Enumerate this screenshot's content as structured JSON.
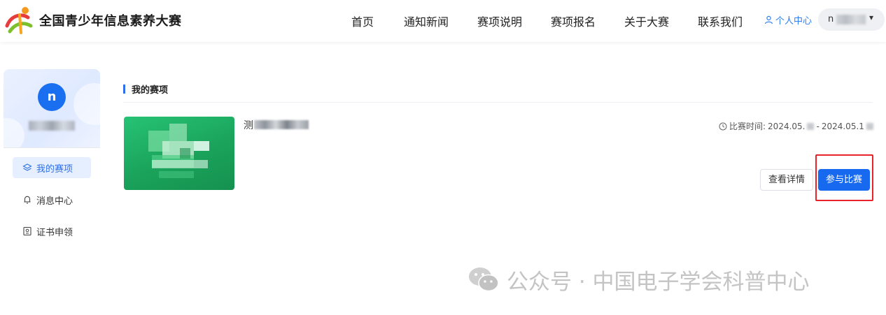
{
  "header": {
    "brand": "全国青少年信息素养大赛",
    "nav": [
      {
        "label": "首页"
      },
      {
        "label": "通知新闻"
      },
      {
        "label": "赛项说明"
      },
      {
        "label": "赛项报名"
      },
      {
        "label": "关于大赛"
      },
      {
        "label": "联系我们"
      }
    ],
    "personal_center": "个人中心",
    "user_initial": "n",
    "user_menu_icon": "caret-down-icon"
  },
  "sidebar": {
    "avatar_letter": "n",
    "items": [
      {
        "label": "我的赛项",
        "icon": "layers-icon",
        "active": true
      },
      {
        "label": "消息中心",
        "icon": "bell-icon",
        "active": false
      },
      {
        "label": "证书申领",
        "icon": "certificate-icon",
        "active": false
      }
    ]
  },
  "main": {
    "section_title": "我的赛项",
    "competition": {
      "title_first_char": "测",
      "time_label": "比赛时间:",
      "time_start": "2024.05.",
      "time_separator": " - ",
      "time_end": "2024.05.1",
      "detail_button": "查看详情",
      "join_button": "参与比赛"
    }
  },
  "watermark": {
    "text": "公众号 · 中国电子学会科普中心"
  },
  "colors": {
    "primary": "#1769f0",
    "link": "#2f7ef4",
    "highlight": "#e8232b",
    "thumb_green": "#1aa35b"
  }
}
